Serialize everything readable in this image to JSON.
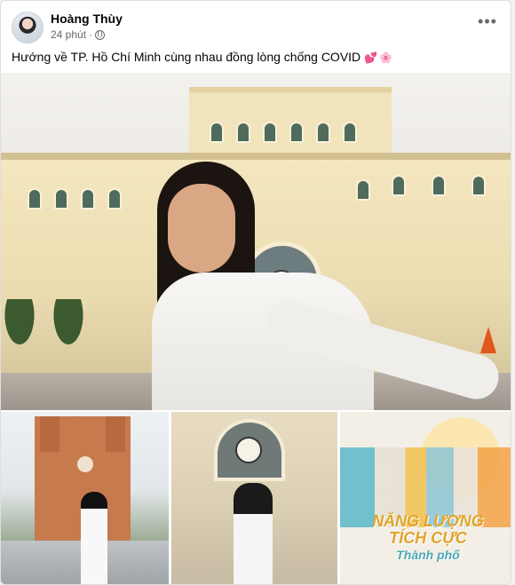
{
  "post": {
    "author": "Hoàng Thùy",
    "time": "24 phút",
    "separator": "·",
    "caption": "Hướng về TP. Hồ Chí Minh cùng nhau đồng lòng chống COVID",
    "more_label": "•••"
  },
  "icons": {
    "avatar": "avatar",
    "privacy": "globe-icon",
    "more": "more-options-icon",
    "emoji1": "heart-emoji-icon",
    "emoji2": "flower-emoji-icon"
  },
  "photos": {
    "main": "selfie-central-post-office",
    "thumbs": [
      "cathedral-ao-dai",
      "post-office-ao-dai",
      "nang-luong-tich-cuc-poster"
    ],
    "poster_title": "NĂNG LƯỢNG TÍCH CỰC",
    "poster_subtitle": "Thành phố"
  },
  "colors": {
    "text": "#050505",
    "secondary": "#65676b",
    "card": "#ffffff",
    "poster_accent": "#e1a52b"
  }
}
